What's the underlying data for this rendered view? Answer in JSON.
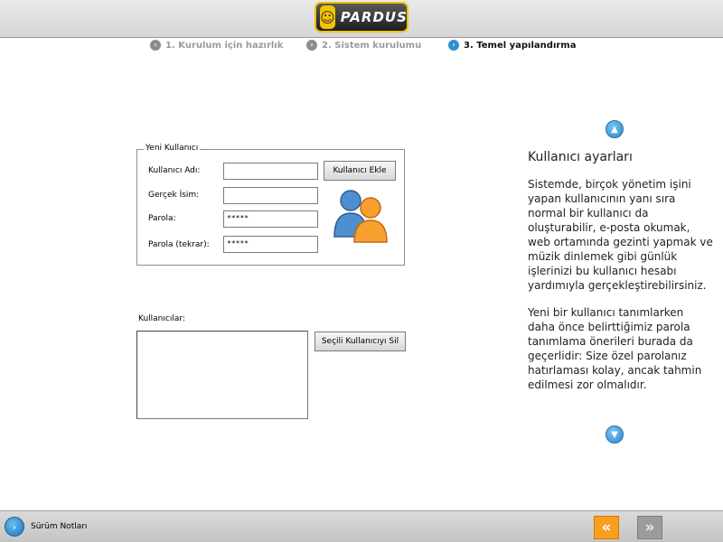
{
  "header": {
    "logo_text": "PARDUS"
  },
  "steps": [
    {
      "number": "1.",
      "label": "Kurulum için hazırlık",
      "active": false
    },
    {
      "number": "2.",
      "label": "Sistem kurulumu",
      "active": false
    },
    {
      "number": "3.",
      "label": "Temel yapılandırma",
      "active": true
    }
  ],
  "new_user": {
    "legend": "Yeni Kullanıcı",
    "username_label": "Kullanıcı Adı:",
    "username_value": "",
    "realname_label": "Gerçek İsim:",
    "realname_value": "",
    "password_label": "Parola:",
    "password_value": "*****",
    "password_repeat_label": "Parola (tekrar):",
    "password_repeat_value": "*****",
    "add_button": "Kullanıcı Ekle"
  },
  "users": {
    "label": "Kullanıcılar:",
    "items": [],
    "delete_button": "Seçili Kullanıcıyı Sil"
  },
  "help": {
    "title": "Kullanıcı ayarları",
    "paragraphs": [
      "Sistemde, birçok yönetim işini yapan kullanıcının yanı sıra normal bir kullanıcı da oluşturabilir, e-posta okumak, web ortamında gezinti yapmak ve müzik dinlemek gibi günlük işlerinizi bu kullanıcı hesabı yardımıyla gerçekleştirebilirsiniz.",
      "Yeni bir kullanıcı tanımlarken daha önce belirttiğimiz parola tanımlama önerileri burada da geçerlidir: Size özel parolanız hatırlaması kolay, ancak tahmin edilmesi zor olmalıdır."
    ]
  },
  "footer": {
    "release_notes": "Sürüm Notları"
  },
  "icons": {
    "step_bullet": "chevron-right-icon",
    "scroll_up": "chevron-up-icon",
    "scroll_down": "chevron-down-icon",
    "prev": "double-chevron-left-icon",
    "next": "double-chevron-right-icon"
  },
  "colors": {
    "accent_blue": "#2f8fd0",
    "prev_button": "#f7a020",
    "next_button": "#9c9c9c"
  }
}
